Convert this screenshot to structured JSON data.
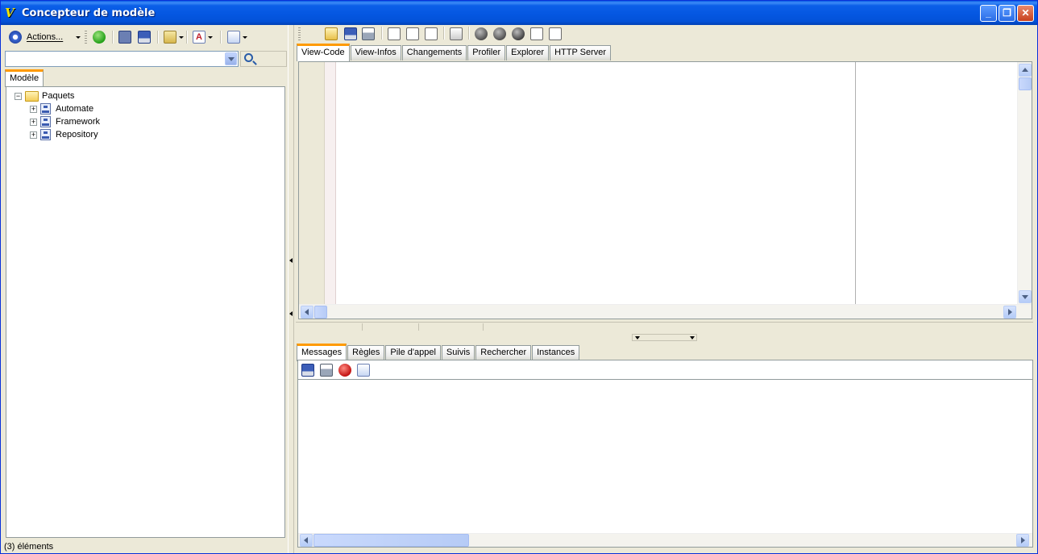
{
  "window": {
    "title": "Concepteur de modèle",
    "app_icon_glyph": "V"
  },
  "left_toolbar": {
    "actions_label": "Actions...",
    "icons": [
      "actions-icon",
      "back-icon",
      "save-all-icon",
      "save-icon",
      "export-icon",
      "text-format-icon",
      "find-icon"
    ]
  },
  "search": {
    "value": "",
    "placeholder": ""
  },
  "model_tab": {
    "label": "Modèle"
  },
  "tree": {
    "root": {
      "label": "Paquets",
      "expander": "−"
    },
    "children": [
      {
        "label": "Automate",
        "expander": "+"
      },
      {
        "label": "Framework",
        "expander": "+"
      },
      {
        "label": "Repository",
        "expander": "+"
      }
    ]
  },
  "status": {
    "text": "(3) éléments"
  },
  "editor_toolbar": {
    "icons": [
      "open-icon",
      "save-icon",
      "print-icon",
      "browse-icon",
      "refresh-icon",
      "delete-icon",
      "compile-icon",
      "run-icon",
      "pause-icon",
      "stop-icon",
      "step-into-icon",
      "step-over-icon"
    ]
  },
  "editor_tabs": [
    "View-Code",
    "View-Infos",
    "Changements",
    "Profiler",
    "Explorer",
    "HTTP Server"
  ],
  "messages_tabs": [
    "Messages",
    "Règles",
    "Pile d'appel",
    "Suivis",
    "Rechercher",
    "Instances"
  ],
  "messages_toolbar": {
    "icons": [
      "save-icon",
      "print-icon",
      "record-icon",
      "clear-icon"
    ]
  },
  "colors": {
    "titlebar": "#0456e0",
    "active_tab_accent": "#ff9a00",
    "chrome": "#ece9d8"
  }
}
